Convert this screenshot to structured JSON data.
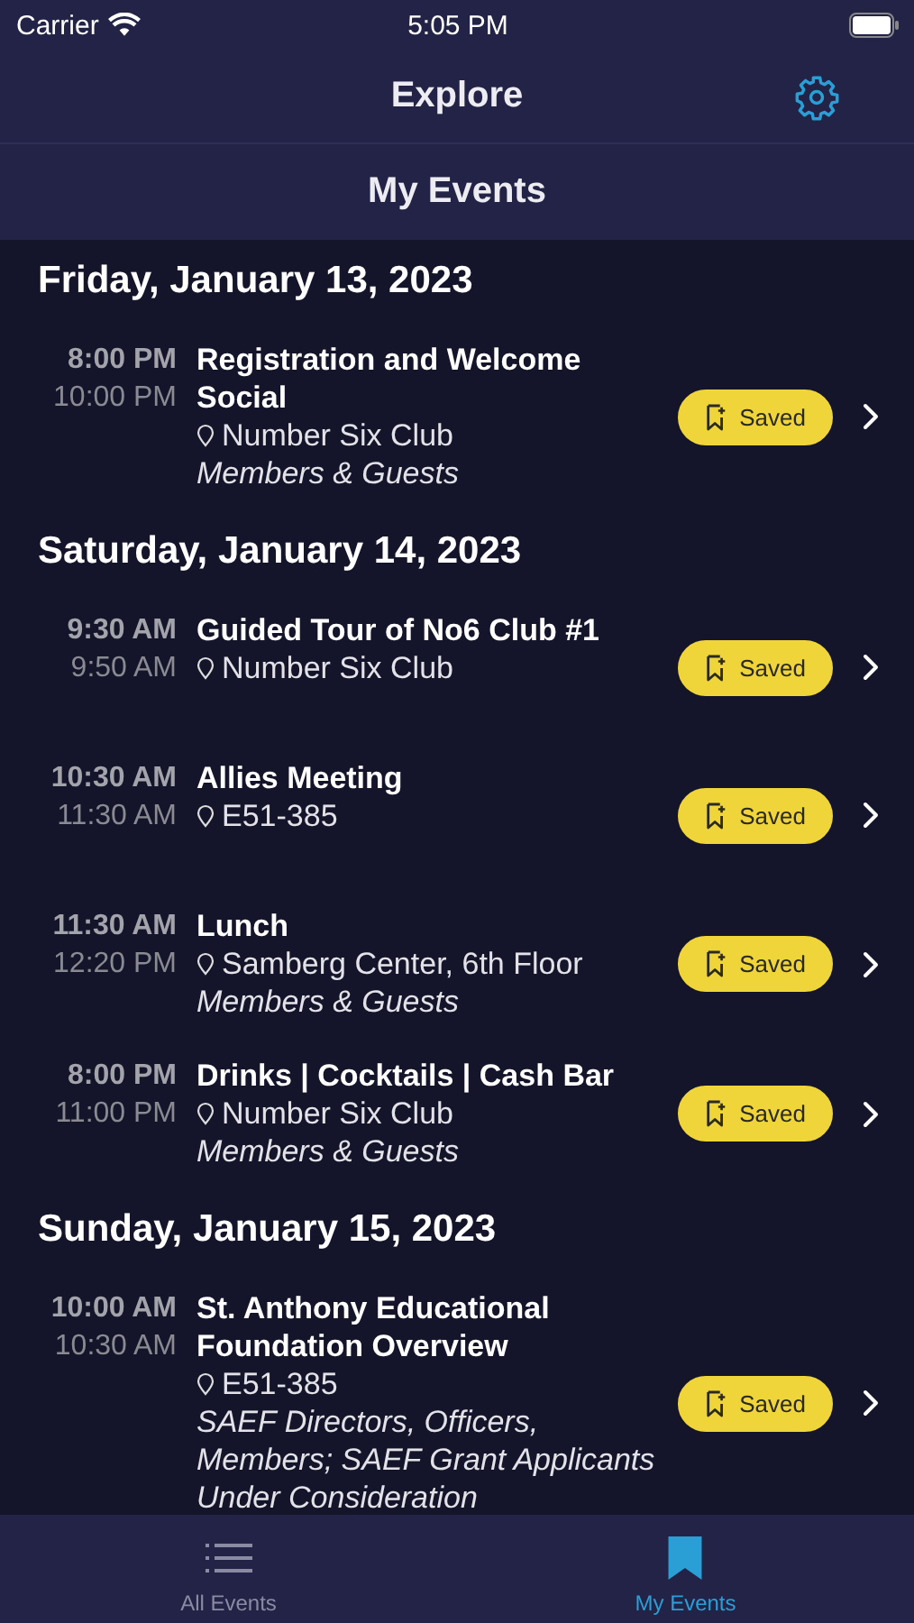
{
  "status_bar": {
    "carrier": "Carrier",
    "time": "5:05 PM"
  },
  "nav": {
    "title": "Explore"
  },
  "section_header": "My Events",
  "days": [
    {
      "date": "Friday, January 13, 2023",
      "events": [
        {
          "start": "8:00 PM",
          "end": "10:00 PM",
          "title": "Registration and Welcome Social",
          "location": "Number Six Club",
          "audience": "Members & Guests",
          "saved": true,
          "button": "Saved"
        }
      ]
    },
    {
      "date": "Saturday, January 14, 2023",
      "events": [
        {
          "start": "9:30 AM",
          "end": "9:50 AM",
          "title": "Guided Tour of No6 Club #1",
          "location": "Number Six Club",
          "saved": true,
          "button": "Saved"
        },
        {
          "start": "10:30 AM",
          "end": "11:30 AM",
          "title": "Allies Meeting",
          "location": "E51-385",
          "saved": true,
          "button": "Saved"
        },
        {
          "start": "11:30 AM",
          "end": "12:20 PM",
          "title": "Lunch",
          "location": "Samberg Center, 6th Floor",
          "audience": "Members & Guests",
          "saved": true,
          "button": "Saved"
        },
        {
          "start": "8:00 PM",
          "end": "11:00 PM",
          "title": "Drinks | Cocktails | Cash Bar",
          "location": "Number Six Club",
          "audience": "Members & Guests",
          "saved": true,
          "button": "Saved"
        }
      ]
    },
    {
      "date": "Sunday, January 15, 2023",
      "events": [
        {
          "start": "10:00 AM",
          "end": "10:30 AM",
          "title": "St. Anthony Educational Foundation Overview",
          "location": "E51-385",
          "audience": "SAEF Directors, Officers, Members; SAEF Grant Applicants Under Consideration",
          "saved": true,
          "button": "Saved"
        }
      ]
    }
  ],
  "tabs": [
    {
      "label": "All Events",
      "kind": "list",
      "selected": false
    },
    {
      "label": "My Events",
      "kind": "bookmark",
      "selected": true
    }
  ]
}
